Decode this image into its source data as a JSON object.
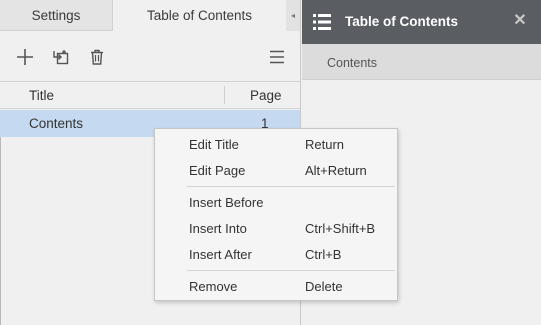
{
  "tabs": {
    "settings": "Settings",
    "table_of_contents": "Table of Contents",
    "collapse_glyph": "◂"
  },
  "toolbar": {
    "add_icon": "plus-icon",
    "insert_icon": "insert-into-icon",
    "delete_icon": "trash-icon",
    "menu_icon": "hamburger-icon"
  },
  "table": {
    "columns": [
      "Title",
      "Page"
    ],
    "rows": [
      {
        "title": "Contents",
        "page": "1"
      }
    ]
  },
  "right_panel": {
    "title": "Table of Contents",
    "close_glyph": "✕",
    "entries": [
      "Contents"
    ]
  },
  "context_menu": {
    "items": [
      {
        "label": "Edit Title",
        "shortcut": "Return"
      },
      {
        "label": "Edit Page",
        "shortcut": "Alt+Return"
      },
      {
        "label": "Insert Before",
        "shortcut": ""
      },
      {
        "label": "Insert Into",
        "shortcut": "Ctrl+Shift+B"
      },
      {
        "label": "Insert After",
        "shortcut": "Ctrl+B"
      },
      {
        "label": "Remove",
        "shortcut": "Delete"
      }
    ]
  },
  "colors": {
    "selection": "#c5d9f0",
    "dark_header": "#5a5d62",
    "panel_bg": "#f0f0f0"
  }
}
